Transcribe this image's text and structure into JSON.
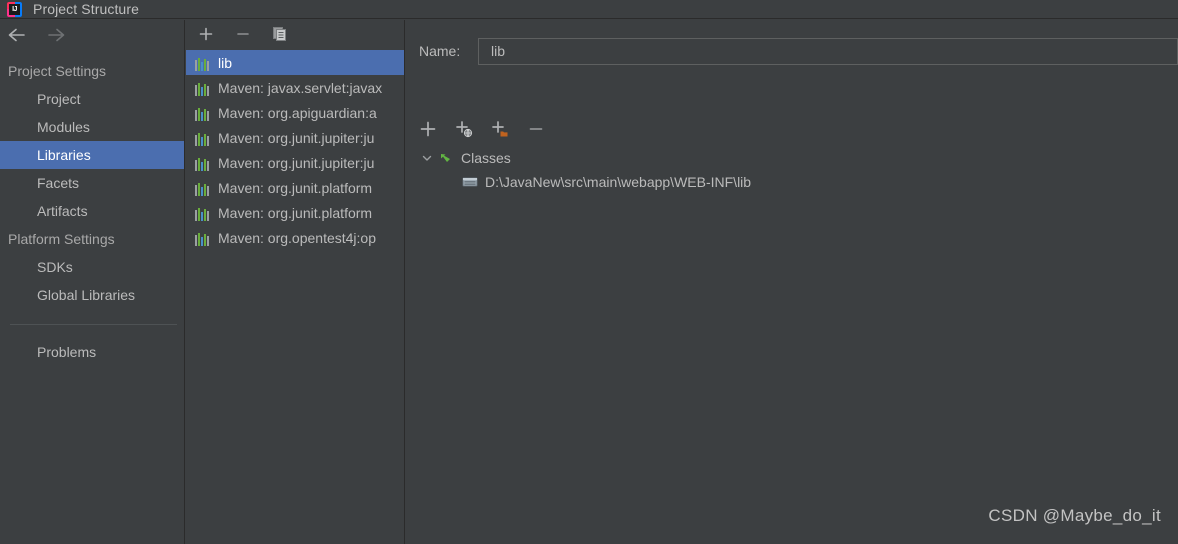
{
  "window": {
    "title": "Project Structure",
    "logo_text": "IJ",
    "logo_icon": "intellij-idea-logo"
  },
  "navigation": {
    "back_icon": "arrow-left-icon",
    "forward_icon": "arrow-right-icon"
  },
  "sidebar": {
    "sections": [
      {
        "header": "Project Settings",
        "items": [
          {
            "label": "Project",
            "selected": false
          },
          {
            "label": "Modules",
            "selected": false
          },
          {
            "label": "Libraries",
            "selected": true
          },
          {
            "label": "Facets",
            "selected": false
          },
          {
            "label": "Artifacts",
            "selected": false
          }
        ]
      },
      {
        "header": "Platform Settings",
        "items": [
          {
            "label": "SDKs",
            "selected": false
          },
          {
            "label": "Global Libraries",
            "selected": false
          }
        ]
      }
    ],
    "extra_items": [
      {
        "label": "Problems",
        "selected": false
      }
    ]
  },
  "library_panel": {
    "toolbar": [
      {
        "name": "add-library-button",
        "icon": "plus-icon",
        "label": "+"
      },
      {
        "name": "remove-library-button",
        "icon": "minus-icon",
        "label": "−"
      },
      {
        "name": "copy-library-button",
        "icon": "copy-icon",
        "label": "Copy"
      }
    ],
    "items": [
      {
        "label": "lib",
        "icon": "library-icon",
        "selected": true
      },
      {
        "label": "Maven: javax.servlet:javax",
        "icon": "library-icon",
        "selected": false
      },
      {
        "label": "Maven: org.apiguardian:a",
        "icon": "library-icon",
        "selected": false
      },
      {
        "label": "Maven: org.junit.jupiter:ju",
        "icon": "library-icon",
        "selected": false
      },
      {
        "label": "Maven: org.junit.jupiter:ju",
        "icon": "library-icon",
        "selected": false
      },
      {
        "label": "Maven: org.junit.platform",
        "icon": "library-icon",
        "selected": false
      },
      {
        "label": "Maven: org.junit.platform",
        "icon": "library-icon",
        "selected": false
      },
      {
        "label": "Maven: org.opentest4j:op",
        "icon": "library-icon",
        "selected": false
      }
    ]
  },
  "detail_panel": {
    "name_label": "Name:",
    "name_value": "lib",
    "name_placeholder": "",
    "toolbar": [
      {
        "name": "add-root-button",
        "icon": "plus-icon"
      },
      {
        "name": "add-from-maven-button",
        "icon": "plus-globe-icon"
      },
      {
        "name": "add-directory-button",
        "icon": "plus-folder-icon"
      },
      {
        "name": "remove-root-button",
        "icon": "minus-icon"
      }
    ],
    "tree": [
      {
        "label": "Classes",
        "icon": "classes-root-icon",
        "expanded": true,
        "chevron": "chevron-down-icon",
        "children": [
          {
            "label": "D:\\JavaNew\\src\\main\\webapp\\WEB-INF\\lib",
            "icon": "archive-icon"
          }
        ]
      }
    ]
  },
  "watermark": {
    "text": "CSDN @Maybe_do_it"
  },
  "colors": {
    "background": "#3C3F41",
    "selection": "#4B6EAF",
    "text": "#BBBBBB",
    "border": "#2B2B2B",
    "accent_green": "#6AAE3C",
    "accent_orange": "#C75B1E"
  }
}
